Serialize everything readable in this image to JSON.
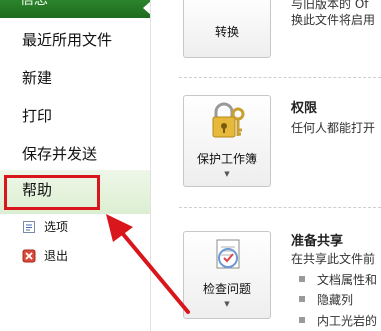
{
  "sidebar": {
    "info_tab": "信息",
    "items": [
      "最近所用文件",
      "新建",
      "打印",
      "保存并发送"
    ],
    "help": "帮助",
    "sub_items": [
      "选项",
      "退出"
    ]
  },
  "content": {
    "top_text_partial": "与旧版本的 Of",
    "convert": {
      "button": "转换",
      "desc": "换此文件将启用"
    },
    "permissions": {
      "button": "保护工作簿",
      "title": "权限",
      "desc": "任何人都能打开"
    },
    "share": {
      "button": "检查问题",
      "title": "准备共享",
      "desc": "在共享此文件前",
      "bullets": [
        "文档属性和",
        "隐藏列",
        "内工光岩的"
      ]
    }
  },
  "colors": {
    "accent_green": "#2f8a2f",
    "highlight_red": "#d9161b"
  }
}
